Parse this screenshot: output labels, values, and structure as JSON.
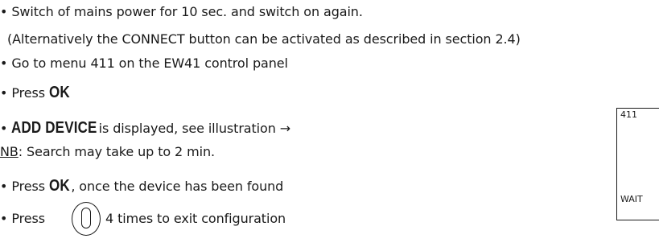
{
  "steps": {
    "s1": "• Switch of mains power for 10 sec. and switch on again.",
    "s1b": "(Alternatively the CONNECT button can be activated as described in section 2.4)",
    "s2": "• Go to menu 411 on the EW41 control panel",
    "s3_prefix": "• Press ",
    "s3_ok": "OK",
    "s4_prefix": "• ",
    "s4_add": "ADD DEVICE",
    "s4_suffix": " is displayed, see illustration →",
    "nb_label": "NB",
    "nb_text": ": Search may take up to 2 min.",
    "s5_prefix": "• Press ",
    "s5_ok": "OK",
    "s5_suffix": ", once the device has been found",
    "s6_prefix": "• Press",
    "s6_suffix": "4 times to exit configuration"
  },
  "display": {
    "menu_number": "411",
    "status": "WAIT"
  },
  "icons": {
    "power_button": "power-button-icon"
  }
}
